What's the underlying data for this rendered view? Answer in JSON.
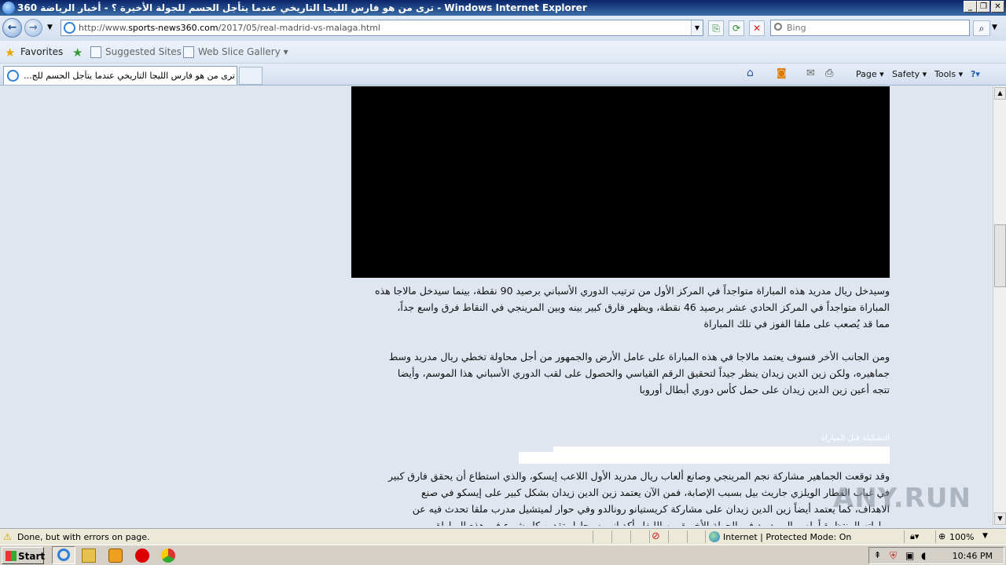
{
  "window": {
    "title": "ترى من هو فارس الليجا التاريخي عندما يتأجل الحسم للجولة الأخيرة ؟ - أخبار الرياضة 360 - Windows Internet Explorer"
  },
  "address_bar": {
    "url_prefix": "http://www.",
    "url_domain": "sports-news360.com",
    "url_path": "/2017/05/real-madrid-vs-malaga.html"
  },
  "search": {
    "placeholder": "Bing"
  },
  "favorites_bar": {
    "favorites_label": "Favorites",
    "items": [
      {
        "label": "Suggested Sites ▾"
      },
      {
        "label": "Web Slice Gallery ▾"
      }
    ]
  },
  "tab": {
    "title": "ترى من هو فارس الليجا التاريخي عندما يتأجل الحسم للج..."
  },
  "command_bar": {
    "page": "Page ▾",
    "safety": "Safety ▾",
    "tools": "Tools ▾",
    "help": "?▾"
  },
  "article": {
    "p1_l1": "وسيدخل ريال مدريد هذه المباراة متواجداً في المركز الأول من ترتيب الدوري الأسباني برصيد 90 نقطة، بينما سيدخل مالاجا هذه",
    "p1_l2": "المباراة متواجداً في المركز الحادي عشر برصيد 46 نقطة، ويظهر فارق كبير بينه وبين المرينجي في النقاط فرق واسع جداً،",
    "p1_l3": "مما قد يُصعب على ملقا الفوز في تلك المباراة",
    "p2_l1": "ومن الجانب الأخر فسوف يعتمد مالاجا في هذه المباراة على عامل الأرض والجمهور من أجل محاولة تخطي ريال مدريد وسط",
    "p2_l2": "جماهيره، ولكن زين الدين زيدان ينظر جيداً لتحقيق الرقم القياسي والحصول على لقب الدوري الأسباني هذا الموسم، وأيضا",
    "p2_l3": "تتجه أعين زين الدين زيدان على حمل كأس دوري أبطال أوروبا",
    "subhead": "التشكيلة قبل المباراة",
    "p3_l1": "وقد توقعت الجماهير مشاركة نجم المرينجي وصانع ألعاب ريال مدريد الأول اللاعب إيسكو، والذي استطاع أن يحقق فارق كبير",
    "p3_l2": "في غياب القطار الويلزي جاريث بيل بسبب الإصابة، فمن الآن يعتمد زين الدين زيدان بشكل كبير على إيسكو في صنع",
    "p3_l3": "الاهداف، كما يعتمد أيضاً زين الدين زيدان على مشاركة كريستيانو رونالدو وفي حوار لميتشيل مدرب ملقا تحدث فيه عن",
    "p3_l4": "مباراته المنتظرة أمام ريال مدريد في الجولة الأخيرة من الليغا وأكد انهو سيحاول تقديم كل شيء في هذه المباراة"
  },
  "watermark": "ANY.RUN",
  "status_bar": {
    "text": "Done, but with errors on page.",
    "zone": "Internet | Protected Mode: On",
    "zoom": "100%"
  },
  "taskbar": {
    "start_label": "Start",
    "clock": "10:46 PM"
  }
}
